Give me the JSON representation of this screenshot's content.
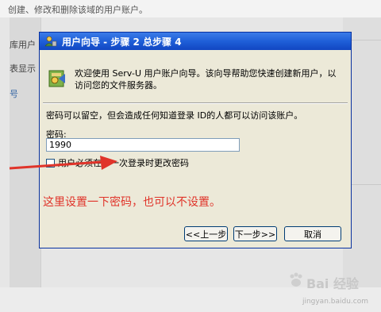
{
  "background": {
    "top_text": "创建、修改和删除该域的用户账户。",
    "left_items": [
      "库用户",
      "表显示",
      "号"
    ]
  },
  "dialog": {
    "title": "用户向导 - 步骤 2 总步骤 4",
    "header_text": "欢迎使用 Serv-U 用户账户向导。该向导帮助您快速创建新用户，以访问您的文件服务器。",
    "info_text": "密码可以留空，但会造成任何知道登录 ID的人都可以访问该账户。",
    "password_label": "密码:",
    "password_value": "1990",
    "checkbox_label": "用户必须在下一次登录时更改密码",
    "checkbox_checked": false,
    "buttons": {
      "back": "<<上一步",
      "next": "下一步>>",
      "cancel": "取消"
    }
  },
  "annotation": "这里设置一下密码，也可以不设置。",
  "watermark": {
    "brand": "Bai 经验",
    "url": "jingyan.baidu.com"
  },
  "colors": {
    "titlebar": "#1f5fd8",
    "annotation": "#e0342a",
    "dialog_bg": "#ece9d8"
  },
  "icons": [
    "user-wizard-icon",
    "wizard-header-icon",
    "checkbox-icon",
    "annotation-arrow-icon",
    "baidu-paw-icon"
  ]
}
